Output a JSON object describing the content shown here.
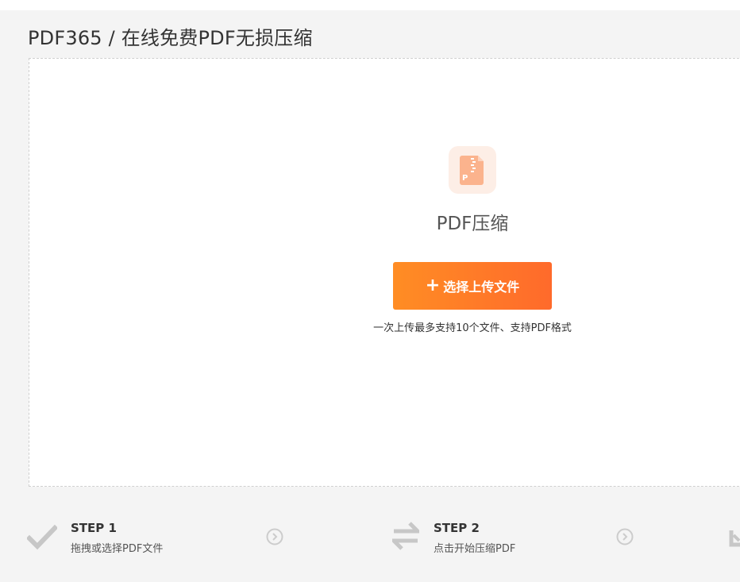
{
  "header": {
    "title": "PDF365 / 在线免费PDF无损压缩"
  },
  "upload": {
    "tool_title": "PDF压缩",
    "button_label": "选择上传文件",
    "button_icon": "plus-icon",
    "hint": "一次上传最多支持10个文件、支持PDF格式",
    "file_icon": "compressed-pdf-file-icon"
  },
  "steps": [
    {
      "title": "STEP 1",
      "desc": "拖拽或选择PDF文件",
      "icon": "checkmark-icon"
    },
    {
      "title": "STEP 2",
      "desc": "点击开始压缩PDF",
      "icon": "swap-arrows-icon"
    }
  ],
  "colors": {
    "accent_start": "#ff8d24",
    "accent_end": "#ff6a2b",
    "icon_bg": "#fdeee6",
    "icon_fg": "#fbb38d",
    "step_icon": "#c7c7c7",
    "page_bg": "#f4f4f4"
  }
}
